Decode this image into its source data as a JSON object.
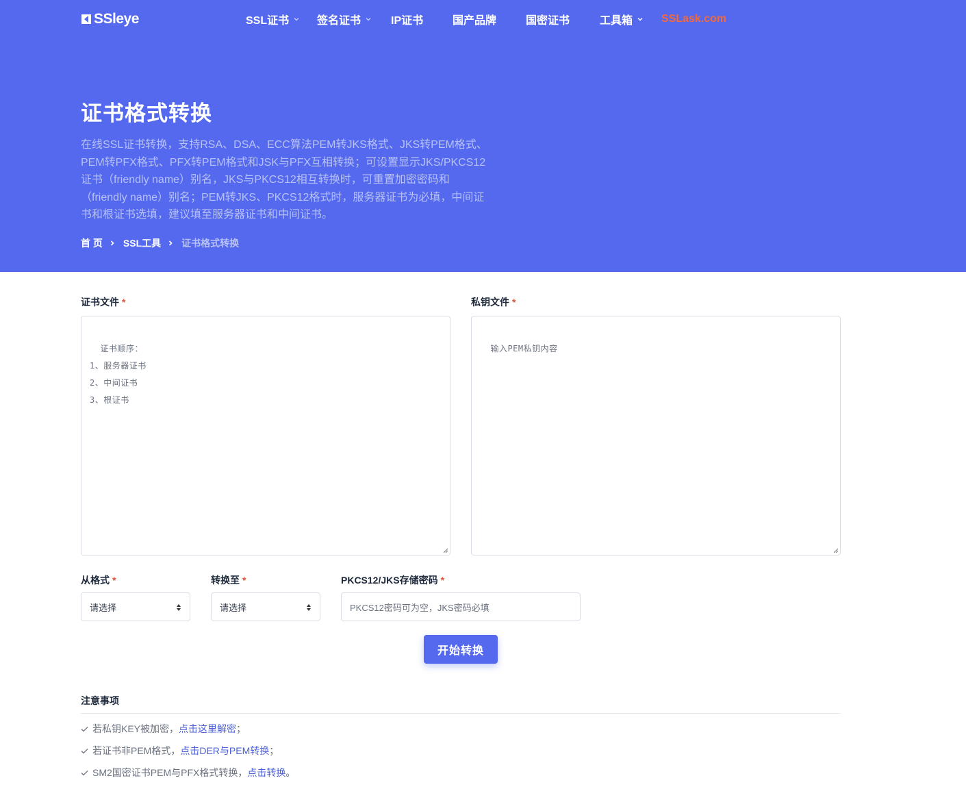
{
  "brand": {
    "name": "SSleye",
    "accent_color": "#5469ee",
    "link_accent": "#f06a3f"
  },
  "nav": {
    "items": [
      {
        "label": "SSL证书",
        "has_dropdown": true
      },
      {
        "label": "签名证书",
        "has_dropdown": true
      },
      {
        "label": "IP证书",
        "has_dropdown": false
      },
      {
        "label": "国产品牌",
        "has_dropdown": false
      },
      {
        "label": "国密证书",
        "has_dropdown": false
      },
      {
        "label": "工具箱",
        "has_dropdown": true
      },
      {
        "label": "SSLask.com",
        "has_dropdown": false
      }
    ]
  },
  "hero": {
    "title": "证书格式转换",
    "description": "在线SSL证书转换，支持RSA、DSA、ECC算法PEM转JKS格式、JKS转PEM格式、PEM转PFX格式、PFX转PEM格式和JSK与PFX互相转换；可设置显示JKS/PKCS12证书（friendly name）别名，JKS与PKCS12相互转换时，可重置加密密码和（friendly name）别名；PEM转JKS、PKCS12格式时，服务器证书为必填，中间证书和根证书选填，建议填至服务器证书和中间证书。",
    "breadcrumb": [
      "首 页",
      "SSL工具",
      "证书格式转换"
    ]
  },
  "form": {
    "cert_label": "证书文件",
    "cert_placeholder": "证书顺序：\n1、服务器证书\n2、中间证书\n3、根证书",
    "key_label": "私钥文件",
    "key_placeholder": "输入PEM私钥内容",
    "from_label": "从格式",
    "from_value": "请选择",
    "to_label": "转换至",
    "to_value": "请选择",
    "password_label": "PKCS12/JKS存储密码",
    "password_placeholder": "PKCS12密码可为空，JKS密码必填",
    "required_mark": "*",
    "submit_label": "开始转换"
  },
  "notes": {
    "title": "注意事项",
    "items": [
      {
        "before": "若私钥KEY被加密，",
        "link": "点击这里解密",
        "after": "；"
      },
      {
        "before": "若证书非PEM格式，",
        "link": "点击DER与PEM转换",
        "after": "；"
      },
      {
        "before": "SM2国密证书PEM与PFX格式转换，",
        "link": "点击转换",
        "after": "。"
      }
    ]
  }
}
